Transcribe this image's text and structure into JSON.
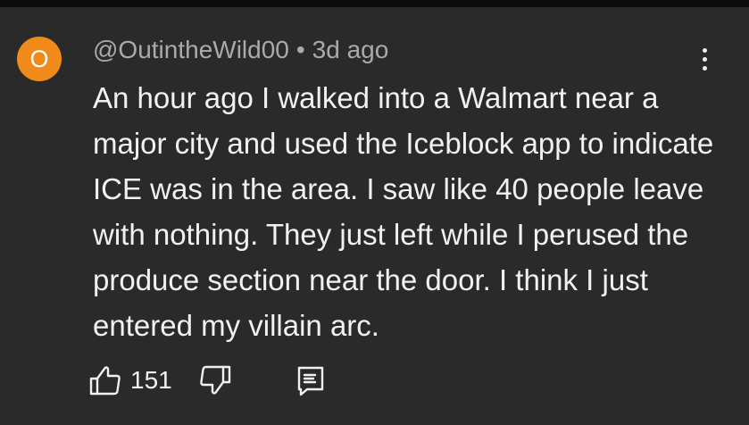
{
  "comment": {
    "avatar_letter": "O",
    "avatar_color": "#ef8a1b",
    "username": "@OutintheWild00",
    "separator": "•",
    "timestamp": "3d ago",
    "text": "An hour ago I walked into a Walmart near a major city and used the Iceblock app to indicate ICE was in the area. I saw like 40 people leave with nothing. They just left while I perused the produce section near the door. I think I just entered my villain arc.",
    "like_count": "151",
    "icons": {
      "like": "thumbs-up-icon",
      "dislike": "thumbs-down-icon",
      "reply": "reply-icon",
      "more": "more-vert-icon"
    }
  }
}
